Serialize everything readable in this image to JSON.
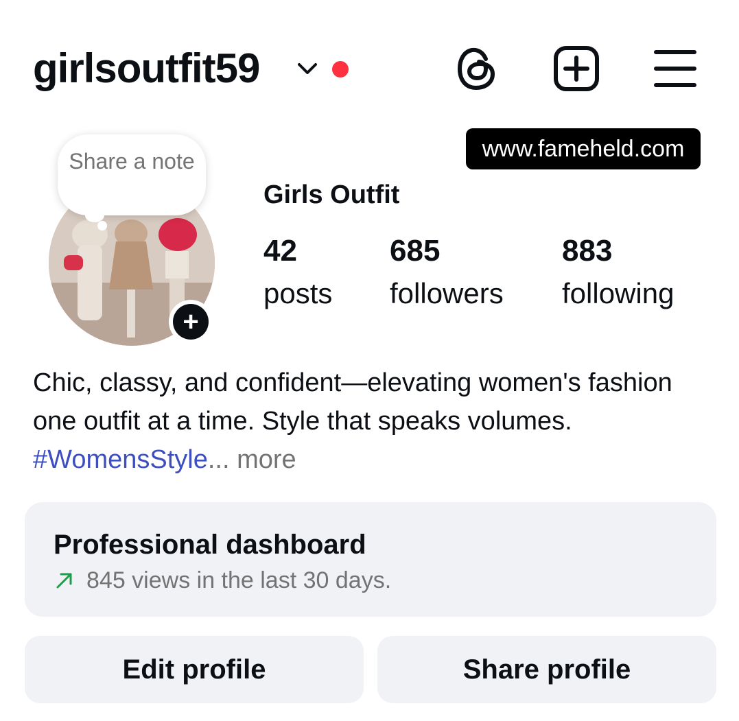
{
  "header": {
    "username": "girlsoutfit59",
    "icons": [
      "chevron-down-icon",
      "notification-dot",
      "threads-icon",
      "create-post-icon",
      "menu-icon"
    ],
    "notification_dot_color": "#ff3040"
  },
  "watermark": "www.fameheld.com",
  "note_bubble": {
    "text": "Share a note"
  },
  "profile": {
    "display_name": "Girls Outfit",
    "stats": [
      {
        "value": "42",
        "label": "posts"
      },
      {
        "value": "685",
        "label": "followers"
      },
      {
        "value": "883",
        "label": "following"
      }
    ]
  },
  "bio": {
    "text": "Chic, classy, and confident—elevating women's fashion one outfit at a time. Style that speaks volumes. ",
    "hashtag": "#WomensStyle",
    "ellipsis": "...",
    "more": " more",
    "hashtag_color": "#3d4ebf"
  },
  "dashboard": {
    "title": "Professional dashboard",
    "subtitle": "845 views in the last 30 days.",
    "arrow_color": "#1a9e4b"
  },
  "buttons": {
    "edit": "Edit profile",
    "share": "Share profile"
  }
}
